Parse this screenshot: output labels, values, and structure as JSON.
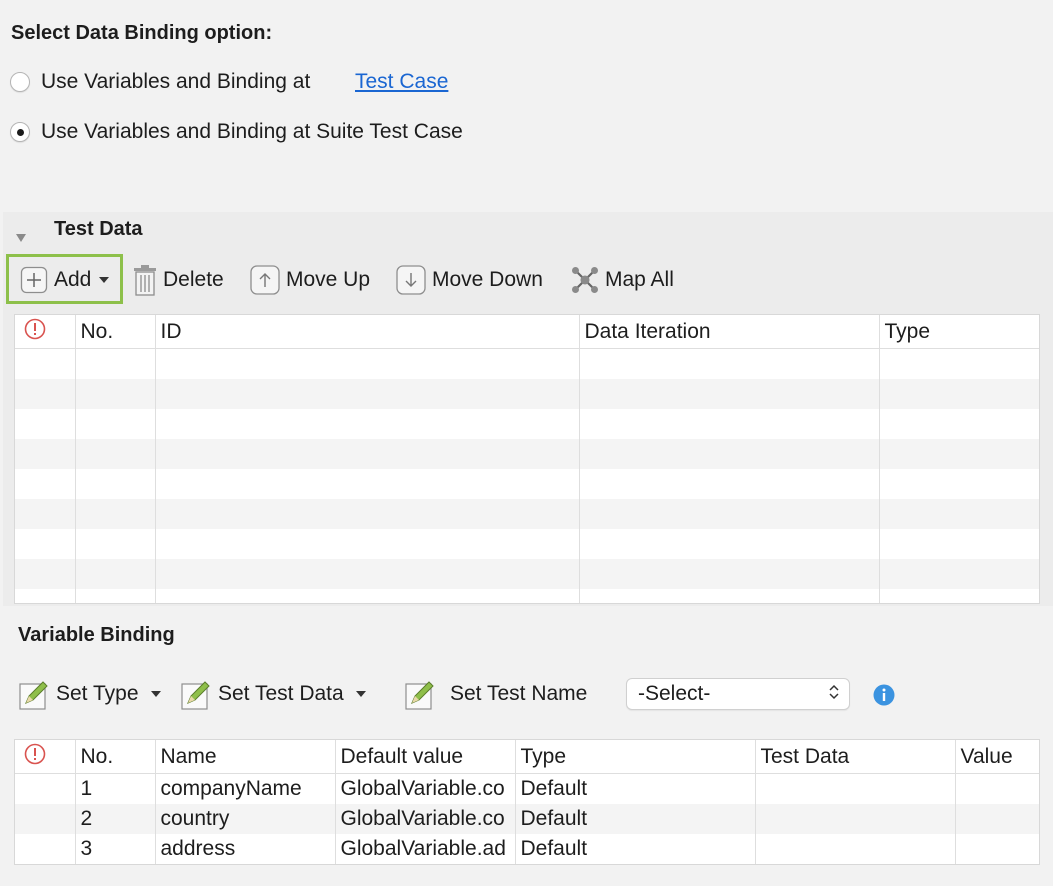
{
  "binding_options": {
    "heading": "Select Data Binding option:",
    "option1_label": "Use Variables and Binding at",
    "option1_link": "Test Case",
    "option2_label": "Use Variables and Binding at Suite Test Case",
    "selected": 2
  },
  "test_data": {
    "title": "Test Data",
    "toolbar": {
      "add": "Add",
      "delete": "Delete",
      "move_up": "Move Up",
      "move_down": "Move Down",
      "map_all": "Map All"
    },
    "columns": [
      "No.",
      "ID",
      "Data Iteration",
      "Type"
    ],
    "rows": []
  },
  "variable_binding": {
    "title": "Variable Binding",
    "toolbar": {
      "set_type": "Set Type",
      "set_test_data": "Set Test Data",
      "set_test_name": "Set Test Name",
      "select_value": "-Select-"
    },
    "columns": [
      "No.",
      "Name",
      "Default value",
      "Type",
      "Test Data",
      "Value"
    ],
    "rows": [
      {
        "no": "1",
        "name": "companyName",
        "default_value": "GlobalVariable.co",
        "type": "Default",
        "test_data": "",
        "value": ""
      },
      {
        "no": "2",
        "name": "country",
        "default_value": "GlobalVariable.co",
        "type": "Default",
        "test_data": "",
        "value": ""
      },
      {
        "no": "3",
        "name": "address",
        "default_value": "GlobalVariable.ad",
        "type": "Default",
        "test_data": "",
        "value": ""
      }
    ]
  },
  "colors": {
    "link": "#1a66d2",
    "highlight_border": "#8dc04a",
    "error_icon": "#d9534f",
    "info_icon": "#3b93e0",
    "pencil_green": "#8fbf4a"
  },
  "icons": {
    "error": "error-circle-icon",
    "info": "info-icon",
    "add": "plus-square-icon",
    "delete": "trash-icon",
    "move_up": "arrow-up-icon",
    "move_down": "arrow-down-icon",
    "map_all": "network-icon",
    "edit": "pencil-icon",
    "collapse": "triangle-down-icon"
  }
}
